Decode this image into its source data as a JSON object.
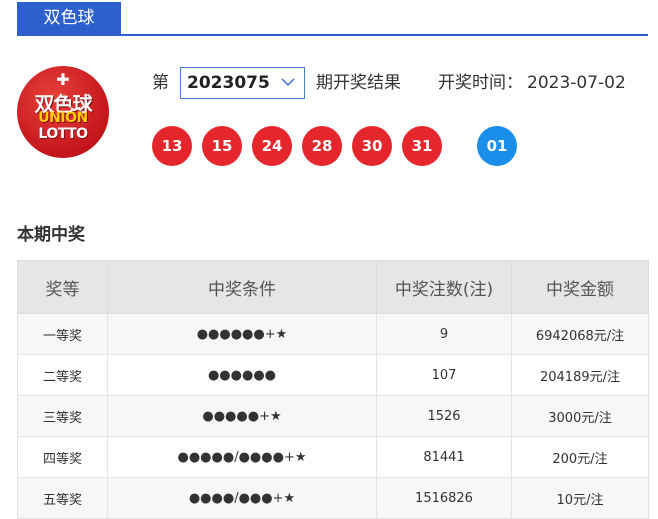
{
  "tab": {
    "label": "双色球"
  },
  "logo": {
    "cn": "双色球",
    "en_line1": "UNION",
    "en_line2": "LOTTO"
  },
  "issue": {
    "prefix": "第",
    "selected": "2023075",
    "suffix": "期开奖结果",
    "date_label": "开奖时间：",
    "date_value": "2023-07-02"
  },
  "balls": {
    "red": [
      "13",
      "15",
      "24",
      "28",
      "30",
      "31"
    ],
    "blue": [
      "01"
    ],
    "colors": {
      "red": "#e5262c",
      "blue": "#1a8ee8"
    }
  },
  "section_title": "本期中奖",
  "table": {
    "headers": [
      "奖等",
      "中奖条件",
      "中奖注数(注)",
      "中奖金额"
    ],
    "rows": [
      [
        "一等奖",
        "●●●●●●+★",
        "9",
        "6942068元/注"
      ],
      [
        "二等奖",
        "●●●●●●",
        "107",
        "204189元/注"
      ],
      [
        "三等奖",
        "●●●●●+★",
        "1526",
        "3000元/注"
      ],
      [
        "四等奖",
        "●●●●●/●●●●+★",
        "81441",
        "200元/注"
      ],
      [
        "五等奖",
        "●●●●/●●●+★",
        "1516826",
        "10元/注"
      ]
    ]
  },
  "accent_color": "#2d5fcf"
}
